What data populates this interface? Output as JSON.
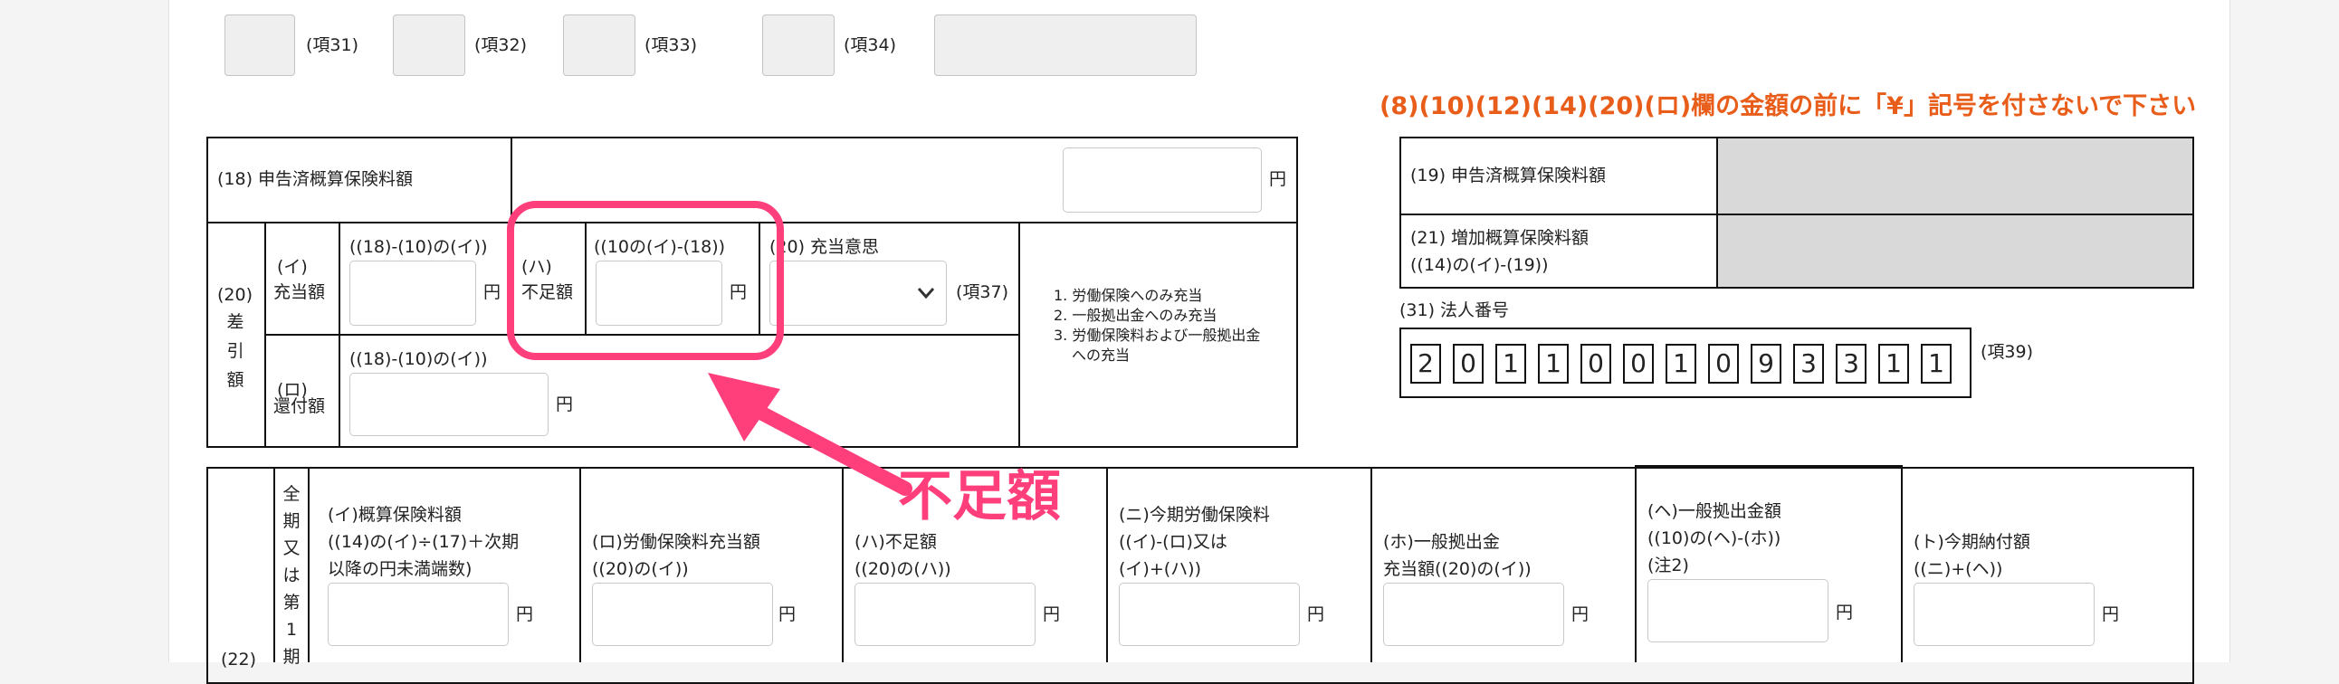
{
  "top_row": {
    "fields": [
      {
        "label": "(項31)"
      },
      {
        "label": "(項32)"
      },
      {
        "label": "(項33)"
      },
      {
        "label": "(項34)"
      }
    ]
  },
  "notice": "(8)(10)(12)(14)(20)(ロ)欄の金額の前に「¥」記号を付さないで下さい",
  "left_table": {
    "r18_label": "(18) 申告済概算保険料額",
    "yen": "円",
    "r20_label_top": "(20)",
    "r20_v": [
      "差",
      "引",
      "額"
    ],
    "i_label": [
      "(イ)",
      "充当額"
    ],
    "i_formula": "((18)-(10)の(イ))",
    "ha_label": [
      "(ハ)",
      "不足額"
    ],
    "ha_formula": "((10の(イ)-(18))",
    "juto_label": "(20) 充当意思",
    "juto_code": "(項37)",
    "options": [
      "1. 労働保険へのみ充当",
      "2. 一般拠出金へのみ充当",
      "3. 労働保険料および一般拠出金",
      "への充当"
    ],
    "ro_label": [
      "(ロ)",
      "還付額"
    ],
    "ro_formula": "((18)-(10)の(イ))"
  },
  "right_table": {
    "r19_label": "(19) 申告済概算保険料額",
    "r21_label": [
      "(21) 増加概算保険料額",
      "((14)の(イ)-(19))"
    ],
    "corp_label": "(31) 法人番号",
    "corp_digits": [
      "2",
      "0",
      "1",
      "1",
      "0",
      "0",
      "1",
      "0",
      "9",
      "3",
      "3",
      "1",
      "1"
    ],
    "corp_code": "(項39)"
  },
  "bottom_table": {
    "left_num": "(22)",
    "vertical": [
      "全",
      "期",
      "又",
      "は",
      "第",
      "1",
      "期"
    ],
    "cols": [
      {
        "lines": [
          "(イ)概算保険料額",
          "((14)の(イ)÷(17)＋次期",
          "以降の円未満端数)"
        ]
      },
      {
        "lines": [
          "(ロ)労働保険料充当額",
          "((20)の(イ))"
        ]
      },
      {
        "lines": [
          "(ハ)不足額",
          "((20)の(ハ))"
        ]
      },
      {
        "lines": [
          "(ニ)今期労働保険料",
          "((イ)-(ロ)又は",
          "(イ)+(ハ))"
        ]
      },
      {
        "lines": [
          "(ホ)一般拠出金",
          "充当額((20)の(イ))"
        ]
      },
      {
        "lines": [
          "(ヘ)一般拠出金額",
          "((10)の(ヘ)-(ホ))",
          "(注2)"
        ]
      },
      {
        "lines": [
          "(ト)今期納付額",
          "((ニ)+(ヘ))"
        ]
      }
    ]
  },
  "annotation": {
    "label": "不足額",
    "color": "#ff3f7c"
  }
}
